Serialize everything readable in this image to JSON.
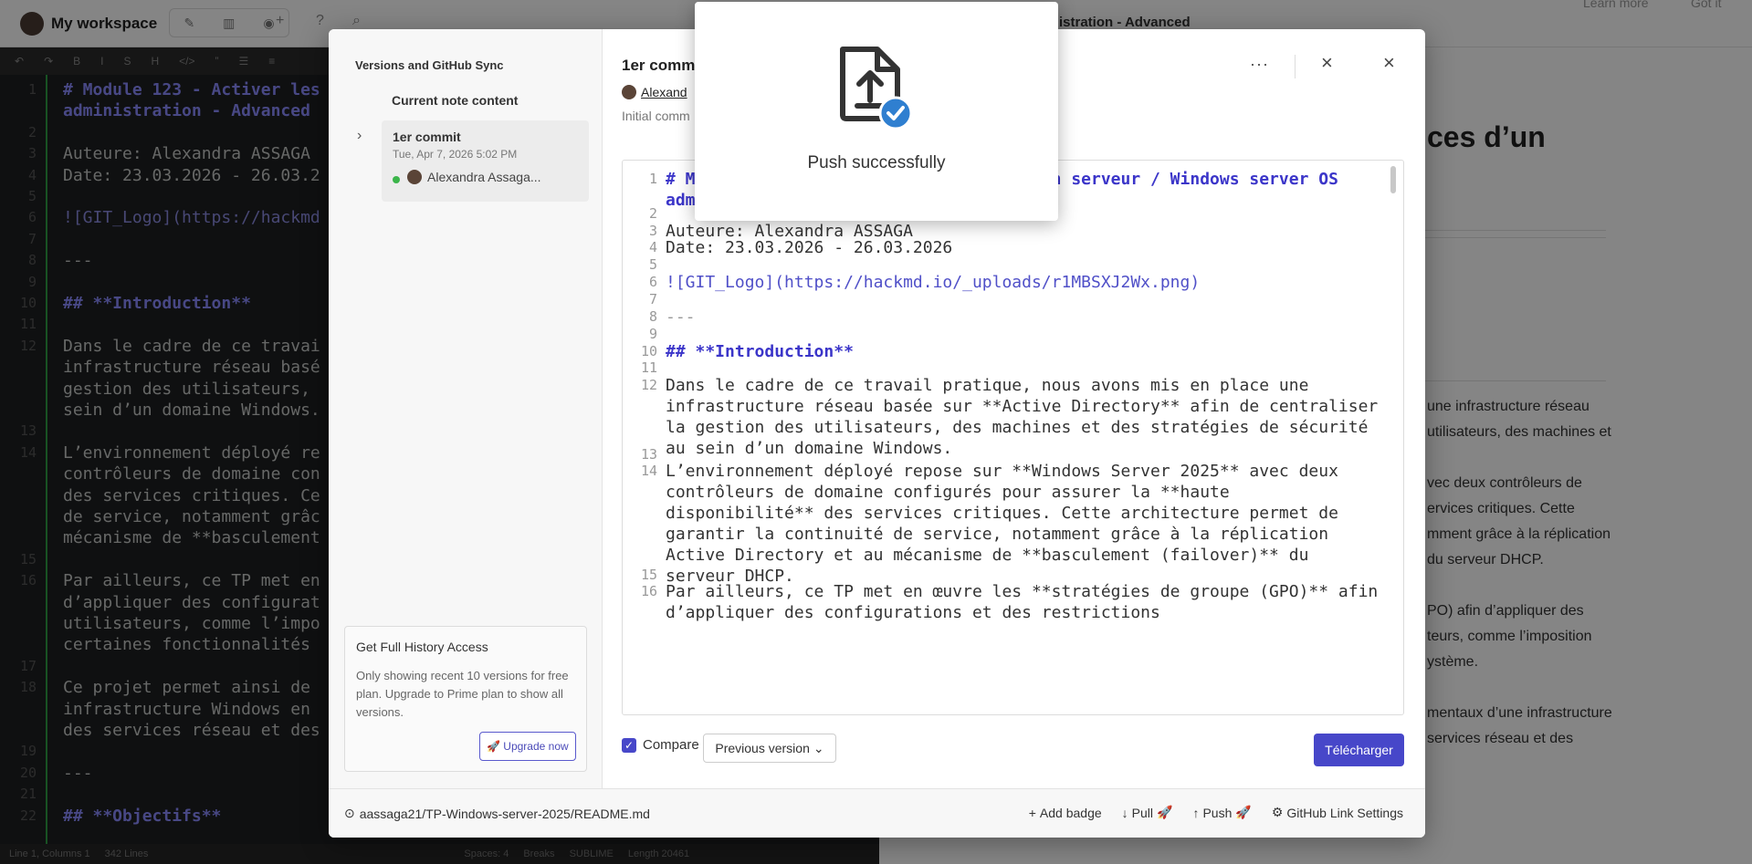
{
  "app": {
    "workspace": "My workspace",
    "note_title_fragment": "istration - Advanced",
    "learn_more": "Learn more",
    "got_it": "Got it"
  },
  "editor": {
    "lines": [
      {
        "n": "1",
        "text": "# Module 123 - Activer les",
        "style": "h"
      },
      {
        "n": "",
        "text": "administration - Advanced",
        "style": "h"
      },
      {
        "n": "2",
        "text": "",
        "style": ""
      },
      {
        "n": "3",
        "text": "Auteure: Alexandra ASSAGA",
        "style": ""
      },
      {
        "n": "4",
        "text": "Date: 23.03.2026 - 26.03.2",
        "style": ""
      },
      {
        "n": "5",
        "text": "",
        "style": ""
      },
      {
        "n": "6",
        "text": "![GIT_Logo](https://hackmd",
        "style": "l"
      },
      {
        "n": "7",
        "text": "",
        "style": ""
      },
      {
        "n": "8",
        "text": "---",
        "style": ""
      },
      {
        "n": "9",
        "text": "",
        "style": ""
      },
      {
        "n": "10",
        "text": "## **Introduction**",
        "style": "h"
      },
      {
        "n": "11",
        "text": "",
        "style": ""
      },
      {
        "n": "12",
        "text": "Dans le cadre de ce travai",
        "style": ""
      },
      {
        "n": "",
        "text": "infrastructure réseau basé",
        "style": ""
      },
      {
        "n": "",
        "text": "gestion des utilisateurs,",
        "style": ""
      },
      {
        "n": "",
        "text": "sein d’un domaine Windows.",
        "style": ""
      },
      {
        "n": "13",
        "text": "",
        "style": ""
      },
      {
        "n": "14",
        "text": "L’environnement déployé re",
        "style": ""
      },
      {
        "n": "",
        "text": "contrôleurs de domaine con",
        "style": ""
      },
      {
        "n": "",
        "text": "des services critiques. Ce",
        "style": ""
      },
      {
        "n": "",
        "text": "de service, notamment grâc",
        "style": ""
      },
      {
        "n": "",
        "text": "mécanisme de **basculement",
        "style": ""
      },
      {
        "n": "15",
        "text": "",
        "style": ""
      },
      {
        "n": "16",
        "text": "Par ailleurs, ce TP met en",
        "style": ""
      },
      {
        "n": "",
        "text": "d’appliquer des configurat",
        "style": ""
      },
      {
        "n": "",
        "text": "utilisateurs, comme l’impo",
        "style": ""
      },
      {
        "n": "",
        "text": "certaines fonctionnalités",
        "style": ""
      },
      {
        "n": "17",
        "text": "",
        "style": ""
      },
      {
        "n": "18",
        "text": "Ce projet permet ainsi de",
        "style": ""
      },
      {
        "n": "",
        "text": "infrastructure Windows en",
        "style": ""
      },
      {
        "n": "",
        "text": "des services réseau et des",
        "style": ""
      },
      {
        "n": "19",
        "text": "",
        "style": ""
      },
      {
        "n": "20",
        "text": "---",
        "style": ""
      },
      {
        "n": "21",
        "text": "",
        "style": ""
      },
      {
        "n": "22",
        "text": "## **Objectifs**",
        "style": "h"
      }
    ]
  },
  "status_bar": {
    "position": "Line 1, Columns 1",
    "lines": "342 Lines",
    "spaces": "Spaces: 4",
    "breaks": "Breaks",
    "keymap": "SUBLIME",
    "length": "Length 20461"
  },
  "preview": {
    "title_fragment": "ces d’un",
    "paragraphs": [
      "une infrastructure réseau",
      "utilisateurs, des machines et",
      "vec deux contrôleurs de",
      "ervices critiques. Cette",
      "mment grâce à la réplication",
      "du serveur DHCP.",
      "PO) afin d’appliquer des",
      "teurs, comme l’imposition",
      "ystème.",
      "mentaux d’une infrastructure",
      "services réseau et des"
    ]
  },
  "modal": {
    "sidebar_title": "Versions and GitHub Sync",
    "current_label": "Current note content",
    "commit": {
      "name": "1er commit",
      "date": "Tue, Apr 7, 2026 5:02 PM",
      "author": "Alexandra Assaga..."
    },
    "upsell": {
      "title": "Get Full History Access",
      "body": "Only showing recent 10 versions for free plan. Upgrade to Prime plan to show all versions.",
      "button": "Upgrade now"
    },
    "main_title": "1er comm",
    "author": "Alexand",
    "message": "Initial comm",
    "diff_lines": [
      {
        "n": "1",
        "text": "# Module 123 - Activer les services d’un serveur / Windows server OS administration - Advanced",
        "style": "h"
      },
      {
        "n": "2",
        "text": "",
        "style": ""
      },
      {
        "n": "3",
        "text": "Auteure: Alexandra ASSAGA",
        "style": ""
      },
      {
        "n": "4",
        "text": "Date: 23.03.2026 - 26.03.2026",
        "style": ""
      },
      {
        "n": "5",
        "text": "",
        "style": ""
      },
      {
        "n": "6",
        "text": "![GIT_Logo](https://hackmd.io/_uploads/r1MBSXJ2Wx.png)",
        "style": "lk"
      },
      {
        "n": "7",
        "text": "",
        "style": ""
      },
      {
        "n": "8",
        "text": "---",
        "style": "g"
      },
      {
        "n": "9",
        "text": "",
        "style": ""
      },
      {
        "n": "10",
        "text": "## **Introduction**",
        "style": "h"
      },
      {
        "n": "11",
        "text": "",
        "style": ""
      },
      {
        "n": "12",
        "text": "Dans le cadre de ce travail pratique, nous avons mis en place une infrastructure réseau basée sur **Active Directory** afin de centraliser la gestion des utilisateurs, des machines et des stratégies de sécurité au sein d’un domaine Windows.",
        "style": ""
      },
      {
        "n": "13",
        "text": "",
        "style": ""
      },
      {
        "n": "14",
        "text": "L’environnement déployé repose sur **Windows Server 2025** avec deux contrôleurs de domaine configurés pour assurer la **haute disponibilité** des services critiques. Cette architecture permet de garantir la continuité de service, notamment grâce à la réplication Active Directory et au mécanisme de **basculement (failover)** du serveur DHCP.",
        "style": ""
      },
      {
        "n": "15",
        "text": "",
        "style": ""
      },
      {
        "n": "16",
        "text": "Par ailleurs, ce TP met en œuvre les **stratégies de groupe (GPO)** afin d’appliquer des configurations et des restrictions",
        "style": ""
      }
    ],
    "compare_label": "Compare",
    "previous_version": "Previous version",
    "download_button": "Télécharger",
    "repo_path": "aassaga21/TP-Windows-server-2025/README.md",
    "add_badge": "Add badge",
    "pull": "Pull",
    "push": "Push",
    "github_settings": "GitHub Link Settings"
  },
  "toast": {
    "message": "Push successfully"
  },
  "colors": {
    "accent": "#4747c9",
    "success_badge": "#2f7fd0",
    "online_dot": "#3bb54a"
  }
}
